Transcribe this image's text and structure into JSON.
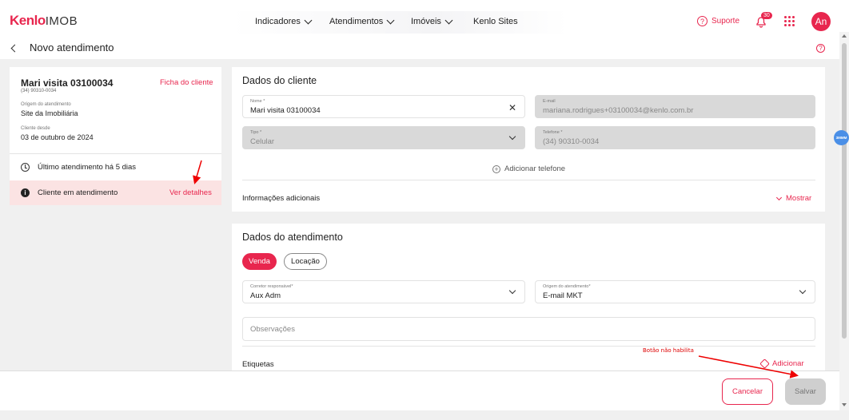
{
  "brand": {
    "name": "Kenlo",
    "product": "IMOB"
  },
  "nav": {
    "items": [
      "Indicadores",
      "Atendimentos",
      "Imóveis",
      "Kenlo Sites"
    ],
    "support_label": "Suporte",
    "notification_count": "30",
    "avatar_initials": "An"
  },
  "page": {
    "title": "Novo atendimento"
  },
  "client_card": {
    "name": "Mari visita 03100034",
    "phone": "(34) 90310-0034",
    "ficha_link": "Ficha do cliente",
    "origin_label": "Origem do atendimento",
    "origin_value": "Site da Imobiliária",
    "since_label": "Cliente desde",
    "since_value": "03 de outubro de 2024",
    "last_service": "Último atendimento há 5 dias",
    "alert_text": "Cliente em atendimento",
    "alert_link": "Ver detalhes"
  },
  "client_data": {
    "title": "Dados do cliente",
    "name_label": "Nome *",
    "name_value": "Mari visita 03100034",
    "email_label": "E-mail",
    "email_value": "mariana.rodrigues+03100034@kenlo.com.br",
    "type_label": "Tipo *",
    "type_value": "Celular",
    "phone_label": "Telefone *",
    "phone_value": "(34) 90310-0034",
    "add_phone": "Adicionar telefone",
    "extra_info": "Informações adicionais",
    "show_label": "Mostrar"
  },
  "service_data": {
    "title": "Dados do atendimento",
    "tabs": [
      "Venda",
      "Locação"
    ],
    "broker_label": "Corretor responsável*",
    "broker_value": "Aux Adm",
    "origin_label": "Origem do atendimento*",
    "origin_value": "E-mail MKT",
    "notes_placeholder": "Observações",
    "tags_label": "Etiquetas",
    "tags_add": "Adicionar"
  },
  "annotation": {
    "text": "Botão não habilita"
  },
  "footer": {
    "cancel": "Cancelar",
    "save": "Salvar"
  },
  "floating_badge": "3MMM",
  "colors": {
    "accent": "#e8264e",
    "alert_bg": "#fbe3e3",
    "disabled": "#d9d9d9"
  }
}
